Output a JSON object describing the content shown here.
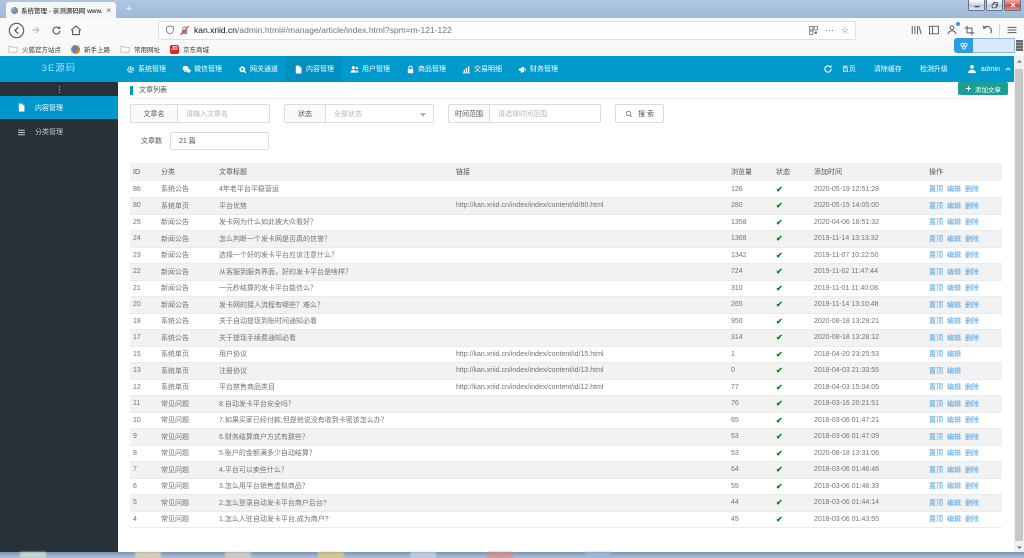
{
  "browser": {
    "tab_title": "系统管理 - 亲测源码网 www.q",
    "tab_close": "×",
    "new_tab": "+",
    "url_domain": "kan.xriid.cn",
    "url_path": "/admin.html#/manage/article/index.html?spm=m-121-122",
    "url_dots": "⋯",
    "url_star": "☆",
    "bookmarks": [
      {
        "label": "火狐官方站点",
        "icon": "folder-icon"
      },
      {
        "label": "新手上路",
        "icon": "firefox-icon"
      },
      {
        "label": "常用网址",
        "icon": "folder-icon"
      },
      {
        "label": "京东商城",
        "icon": "jd-icon"
      }
    ],
    "jd_badge": "JD"
  },
  "admin_header": {
    "logo": "3E源码",
    "nav": [
      {
        "label": "系统管理",
        "icon": "gear-icon",
        "active": false
      },
      {
        "label": "微信管理",
        "icon": "wechat-icon",
        "active": false
      },
      {
        "label": "网关通道",
        "icon": "gateway-icon",
        "active": false
      },
      {
        "label": "内容管理",
        "icon": "document-icon",
        "active": true
      },
      {
        "label": "用户管理",
        "icon": "users-icon",
        "active": false
      },
      {
        "label": "商品管理",
        "icon": "lock-icon",
        "active": false
      },
      {
        "label": "交易明细",
        "icon": "chart-icon",
        "active": false
      },
      {
        "label": "财务管理",
        "icon": "megaphone-icon",
        "active": false
      }
    ],
    "right_links": [
      "首页",
      "清除缓存",
      "检测升级"
    ],
    "user": "admin"
  },
  "sidebar": {
    "items": [
      {
        "label": "内容管理",
        "icon": "document-icon",
        "active": true
      },
      {
        "label": "分类管理",
        "icon": "menu-icon",
        "active": false
      }
    ]
  },
  "page": {
    "title": "文章列表",
    "add_button": "添加文章",
    "filters": {
      "name_label": "文章名",
      "name_placeholder": "请输入文章名",
      "status_label": "状态",
      "status_value": "全部状态",
      "time_label": "时间范围",
      "time_placeholder": "请选择时间范围",
      "search_label": "搜 索",
      "count_label": "文章数",
      "count_value": "21 篇"
    },
    "table": {
      "headers": [
        "ID",
        "分类",
        "文章标题",
        "链接",
        "浏览量",
        "状态",
        "添加时间",
        "操作"
      ],
      "rows": [
        {
          "id": "86",
          "category": "系统公告",
          "title": "4年老平台平稳营运",
          "link": "",
          "views": "126",
          "status": true,
          "time": "2020-05-19 12:51:28",
          "actions": [
            "置顶",
            "编辑",
            "删除"
          ]
        },
        {
          "id": "80",
          "category": "系统单页",
          "title": "平台优势",
          "link": "http://kan.xriid.cn/index/index/content/id/80.html",
          "views": "280",
          "status": true,
          "time": "2020-05-15 14:05:00",
          "actions": [
            "置顶",
            "编辑",
            "删除"
          ]
        },
        {
          "id": "25",
          "category": "新闻公告",
          "title": "发卡网为什么如此被大众看好？",
          "link": "",
          "views": "1358",
          "status": true,
          "time": "2020-04-06 18:51:32",
          "actions": [
            "置顶",
            "编辑",
            "删除"
          ]
        },
        {
          "id": "24",
          "category": "新闻公告",
          "title": "怎么判断一个发卡网是否真的信誉？",
          "link": "",
          "views": "1368",
          "status": true,
          "time": "2019-11-14 13:13:32",
          "actions": [
            "置顶",
            "编辑",
            "删除"
          ]
        },
        {
          "id": "23",
          "category": "新闻公告",
          "title": "选择一个好的发卡平台应该注意什么？",
          "link": "",
          "views": "1342",
          "status": true,
          "time": "2019-11-07 10:22:50",
          "actions": [
            "置顶",
            "编辑",
            "删除"
          ]
        },
        {
          "id": "22",
          "category": "新闻公告",
          "title": "从客服到服务界面，好的发卡平台是啥样？",
          "link": "",
          "views": "724",
          "status": true,
          "time": "2019-11-02 11:47:44",
          "actions": [
            "置顶",
            "编辑",
            "删除"
          ]
        },
        {
          "id": "21",
          "category": "新闻公告",
          "title": "一元秒结算的发卡平台能信么？",
          "link": "",
          "views": "310",
          "status": true,
          "time": "2019-11-01 11:40:08",
          "actions": [
            "置顶",
            "编辑",
            "删除"
          ]
        },
        {
          "id": "20",
          "category": "新闻公告",
          "title": "发卡网的接入流程有哪些？难么？",
          "link": "",
          "views": "265",
          "status": true,
          "time": "2019-11-14 13:10:48",
          "actions": [
            "置顶",
            "编辑",
            "删除"
          ]
        },
        {
          "id": "18",
          "category": "系统公告",
          "title": "关于自动提现到账时间通知必看",
          "link": "",
          "views": "950",
          "status": true,
          "time": "2020-08-18 13:29:21",
          "actions": [
            "置顶",
            "编辑",
            "删除"
          ]
        },
        {
          "id": "17",
          "category": "系统公告",
          "title": "关于提现手续费通知必看",
          "link": "",
          "views": "314",
          "status": true,
          "time": "2020-08-18 13:28:12",
          "actions": [
            "置顶",
            "编辑",
            "删除"
          ]
        },
        {
          "id": "15",
          "category": "系统单页",
          "title": "用户协议",
          "link": "http://kan.xriid.cn/index/index/content/id/15.html",
          "views": "1",
          "status": true,
          "time": "2018-04-20 23:25:53",
          "actions": [
            "置顶",
            "编辑"
          ]
        },
        {
          "id": "13",
          "category": "系统单页",
          "title": "注册协议",
          "link": "http://kan.xriid.cn/index/index/content/id/13.html",
          "views": "0",
          "status": true,
          "time": "2018-04-03 21:33:55",
          "actions": [
            "置顶",
            "编辑"
          ]
        },
        {
          "id": "12",
          "category": "系统单页",
          "title": "平台禁售商品类目",
          "link": "http://kan.xriid.cn/index/index/content/id/12.html",
          "views": "77",
          "status": true,
          "time": "2018-04-03 15:04:05",
          "actions": [
            "置顶",
            "编辑",
            "删除"
          ]
        },
        {
          "id": "11",
          "category": "常见问题",
          "title": "8.自动发卡平台安全吗？",
          "link": "",
          "views": "76",
          "status": true,
          "time": "2018-03-16 20:21:51",
          "actions": [
            "置顶",
            "编辑",
            "删除"
          ]
        },
        {
          "id": "10",
          "category": "常见问题",
          "title": "7.如果买家已经付款,但是他说没有收到卡密该怎么办？",
          "link": "",
          "views": "65",
          "status": true,
          "time": "2018-03-06 01:47:21",
          "actions": [
            "置顶",
            "编辑",
            "删除"
          ]
        },
        {
          "id": "9",
          "category": "常见问题",
          "title": "6.财务结算商户方式有那些？",
          "link": "",
          "views": "53",
          "status": true,
          "time": "2018-03-06 01:47:09",
          "actions": [
            "置顶",
            "编辑",
            "删除"
          ]
        },
        {
          "id": "8",
          "category": "常见问题",
          "title": "5.账户的金额满多少自动结算？",
          "link": "",
          "views": "53",
          "status": true,
          "time": "2020-08-18 13:31:06",
          "actions": [
            "置顶",
            "编辑",
            "删除"
          ]
        },
        {
          "id": "7",
          "category": "常见问题",
          "title": "4.平台可以卖些什么？",
          "link": "",
          "views": "64",
          "status": true,
          "time": "2018-03-06 01:46:46",
          "actions": [
            "置顶",
            "编辑",
            "删除"
          ]
        },
        {
          "id": "6",
          "category": "常见问题",
          "title": "3.怎么用平台销售虚拟商品？",
          "link": "",
          "views": "55",
          "status": true,
          "time": "2018-03-06 01:46:33",
          "actions": [
            "置顶",
            "编辑",
            "删除"
          ]
        },
        {
          "id": "5",
          "category": "常见问题",
          "title": "2.怎么登录自动发卡平台商户后台?",
          "link": "",
          "views": "44",
          "status": true,
          "time": "2018-03-06 01:44:14",
          "actions": [
            "置顶",
            "编辑",
            "删除"
          ]
        },
        {
          "id": "4",
          "category": "常见问题",
          "title": "1.怎么入驻自动发卡平台,成为商户?",
          "link": "",
          "views": "45",
          "status": true,
          "time": "2018-03-06 01:43:55",
          "actions": [
            "置顶",
            "编辑",
            "删除"
          ]
        }
      ],
      "status_check": "✔"
    }
  },
  "colors": {
    "header_blue": "#0099cc",
    "header_active": "#008fbf",
    "sidebar_dark": "#283038",
    "sidebar_active": "#0098cc",
    "add_button_green": "#1a9f93",
    "link_blue": "#4a9ee2",
    "check_green": "#038103",
    "stripe_gray": "#f2f2f2"
  }
}
